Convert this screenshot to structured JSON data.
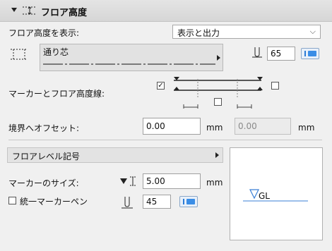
{
  "header": {
    "title": "フロア高度"
  },
  "display": {
    "label": "フロア高度を表示:",
    "value": "表示と出力"
  },
  "line_type": {
    "name": "通り芯",
    "pen_value": "65"
  },
  "marker_line": {
    "label": "マーカーとフロア高度線:"
  },
  "offset": {
    "label": "境界へオフセット:",
    "value1": "0.00",
    "unit1": "mm",
    "value2": "0.00",
    "unit2": "mm"
  },
  "floor_level": {
    "section_title": "フロアレベル記号"
  },
  "marker_size": {
    "label": "マーカーのサイズ:",
    "value": "5.00",
    "unit": "mm"
  },
  "uniform_pen": {
    "label": "統一マーカーペン",
    "checked": false,
    "pen_value": "45"
  },
  "preview": {
    "text": "GL"
  }
}
